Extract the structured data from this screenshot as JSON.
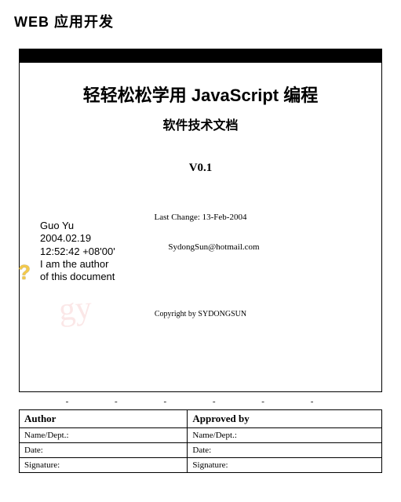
{
  "header": "WEB 应用开发",
  "document": {
    "title": "轻轻松松学用 JavaScript 编程",
    "subtitle": "软件技术文档",
    "version": "V0.1",
    "last_change_label": "Last Change:",
    "last_change_date": "13-Feb-2004",
    "email": "SydongSun@hotmail.com",
    "copyright": "Copyright by SYDONGSUN"
  },
  "signature_stamp": {
    "name": "Guo Yu",
    "date": "2004.02.19",
    "time": "12:52:42 +08'00'",
    "statement_line1": "I am the author",
    "statement_line2": "of this document",
    "watermark": "gy"
  },
  "dots_line": "- - - - - -",
  "approval_table": {
    "col1_header": "Author",
    "col2_header": "Approved by",
    "rows": [
      {
        "label": "Name/Dept.:"
      },
      {
        "label": "Date:"
      },
      {
        "label": "Signature:"
      }
    ]
  }
}
